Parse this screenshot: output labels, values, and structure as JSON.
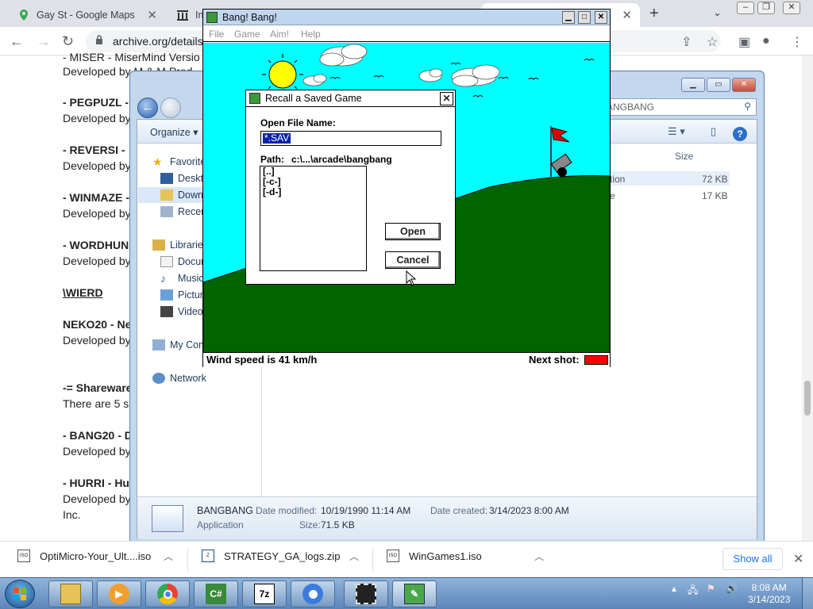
{
  "browser": {
    "tabs": [
      {
        "title": "Gay St - Google Maps"
      },
      {
        "title": "In"
      },
      {
        "title": ""
      }
    ],
    "url": "archive.org/details"
  },
  "page": {
    "lines": [
      {
        "text": "- MISER - MiserMind Versio",
        "bold": false
      },
      {
        "text": "Developed by M & M Prod",
        "bold": false
      },
      {
        "text": "- PEGPUZL -",
        "bold": true
      },
      {
        "text": "Developed by",
        "bold": false
      },
      {
        "text": "- REVERSI -",
        "bold": true
      },
      {
        "text": "Developed by",
        "bold": false
      },
      {
        "text": "- WINMAZE -",
        "bold": true
      },
      {
        "text": "Developed by",
        "bold": false
      },
      {
        "text": "- WORDHUN",
        "bold": true
      },
      {
        "text": "Developed by",
        "bold": false
      },
      {
        "text": "\\WIERD",
        "bold": true
      },
      {
        "text": "NEKO20 - Ne",
        "bold": true
      },
      {
        "text": "Developed by",
        "bold": false
      },
      {
        "text": "-= Shareware",
        "bold": true
      },
      {
        "text": "There are 5 s",
        "bold": false
      },
      {
        "text": "- BANG20 - D",
        "bold": true
      },
      {
        "text": "Developed by",
        "bold": false
      },
      {
        "text": "- HURRI - Hu",
        "bold": true
      },
      {
        "text": "Developed by",
        "bold": false
      },
      {
        "text": "Inc.",
        "bold": false
      }
    ]
  },
  "explorer": {
    "search_placeholder": "ANGBANG",
    "toolbar": {
      "organize": "Organize"
    },
    "nav": {
      "favorites": "Favorite",
      "desktop": "Deskto",
      "downloads": "Downl",
      "recent": "Recent",
      "libraries": "Libraries",
      "documents": "Docum",
      "music": "Music",
      "pictures": "Pictur",
      "videos": "Videos",
      "computer": "My Com",
      "network": "Network"
    },
    "columns": {
      "size": "Size"
    },
    "files": [
      {
        "frag": "tion",
        "size": "72 KB"
      },
      {
        "frag": "e",
        "size": "17 KB"
      }
    ],
    "details": {
      "name": "BANGBANG",
      "type": "Application",
      "modified_label": "Date modified:",
      "modified": "10/19/1990 11:14 AM",
      "created_label": "Date created:",
      "created": "3/14/2023 8:00 AM",
      "size_label": "Size:",
      "size": "71.5 KB"
    }
  },
  "game": {
    "title": "Bang! Bang!",
    "menu": [
      "File",
      "Game",
      "Aim!",
      "Help"
    ],
    "status_wind": "Wind speed is 41 km/h",
    "status_next": "Next shot:",
    "next_shot_color": "#ff0000",
    "sky_color": "#00ffff",
    "grass_color": "#006400"
  },
  "dialog": {
    "title": "Recall a Saved Game",
    "open_label": "Open File Name:",
    "file_value": "*.SAV",
    "path_label": "Path:",
    "path_value": "c:\\...\\arcade\\bangbang",
    "dirs": [
      "[..]",
      "[-c-]",
      "[-d-]"
    ],
    "open_button": "Open",
    "cancel_button": "Cancel",
    "close_glyph": "✕"
  },
  "downloads": {
    "items": [
      {
        "name": "OptiMicro-Your_Ult....iso",
        "icon": "iso-icon"
      },
      {
        "name": "STRATEGY_GA_logs.zip",
        "icon": "zip-icon"
      },
      {
        "name": "WinGames1.iso",
        "icon": "iso-icon"
      }
    ],
    "show_all": "Show all"
  },
  "taskbar": {
    "apps": [
      "explorer",
      "media-player",
      "chrome",
      "csharp-app",
      "7zip",
      "chrome-alt",
      "film-app",
      "bang-bang"
    ],
    "labels": {
      "csharp": "C#",
      "zip": "7z"
    },
    "time": "8:08 AM",
    "date": "3/14/2023"
  }
}
